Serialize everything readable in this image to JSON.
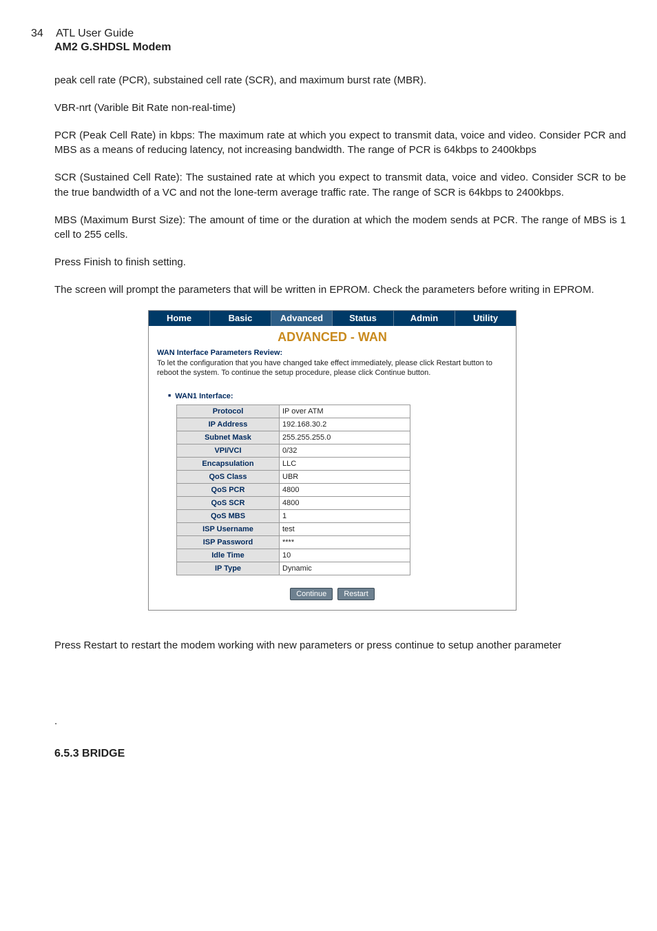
{
  "header": {
    "page_number": "34",
    "guide_title": "ATL User Guide",
    "product_title": "AM2 G.SHDSL Modem"
  },
  "paragraphs": {
    "p1": "peak cell rate (PCR), substained cell rate (SCR), and maximum burst rate (MBR).",
    "p2": "VBR-nrt (Varible Bit Rate non-real-time)",
    "p3": "PCR (Peak Cell Rate) in kbps: The maximum rate at which you expect to transmit data, voice and video. Consider PCR and MBS as a means of reducing latency, not increasing bandwidth. The range of PCR is 64kbps to 2400kbps",
    "p4": "SCR (Sustained Cell Rate): The sustained rate at which you expect to transmit data, voice and video. Consider SCR to be the true bandwidth of a VC and not the lone-term average traffic rate. The range of SCR is 64kbps to 2400kbps.",
    "p5": "MBS (Maximum Burst Size): The amount of time or the duration at which the modem sends at PCR. The range of MBS is 1 cell to 255 cells.",
    "p6": "Press Finish to finish setting.",
    "p7": "The screen will prompt the parameters that will be written in EPROM. Check the parameters before writing in EPROM.",
    "p8": "Press Restart to restart the modem working with new parameters or press continue to setup another parameter"
  },
  "screenshot": {
    "tabs": {
      "home": "Home",
      "basic": "Basic",
      "advanced": "Advanced",
      "status": "Status",
      "admin": "Admin",
      "utility": "Utility"
    },
    "title": "ADVANCED - WAN",
    "review_heading": "WAN Interface Parameters Review:",
    "review_desc": "To let the configuration that you have changed take effect immediately,  please click Restart button to reboot the system.  To continue the setup procedure, please click Continue button.",
    "interface_label": "WAN1 Interface:",
    "table": {
      "protocol": {
        "label": "Protocol",
        "value": "IP over ATM"
      },
      "ip_address": {
        "label": "IP Address",
        "value": "192.168.30.2"
      },
      "subnet_mask": {
        "label": "Subnet Mask",
        "value": "255.255.255.0"
      },
      "vpi_vci": {
        "label": "VPI/VCI",
        "value": "0/32"
      },
      "encapsulation": {
        "label": "Encapsulation",
        "value": "LLC"
      },
      "qos_class": {
        "label": "QoS Class",
        "value": "UBR"
      },
      "qos_pcr": {
        "label": "QoS PCR",
        "value": "4800"
      },
      "qos_scr": {
        "label": "QoS SCR",
        "value": "4800"
      },
      "qos_mbs": {
        "label": "QoS MBS",
        "value": "1"
      },
      "isp_username": {
        "label": "ISP Username",
        "value": "test"
      },
      "isp_password": {
        "label": "ISP Password",
        "value": "****"
      },
      "idle_time": {
        "label": "Idle Time",
        "value": "10"
      },
      "ip_type": {
        "label": "IP Type",
        "value": "Dynamic"
      }
    },
    "buttons": {
      "continue": "Continue",
      "restart": "Restart"
    }
  },
  "footer": {
    "dot": ".",
    "section_heading": "6.5.3  BRIDGE"
  }
}
